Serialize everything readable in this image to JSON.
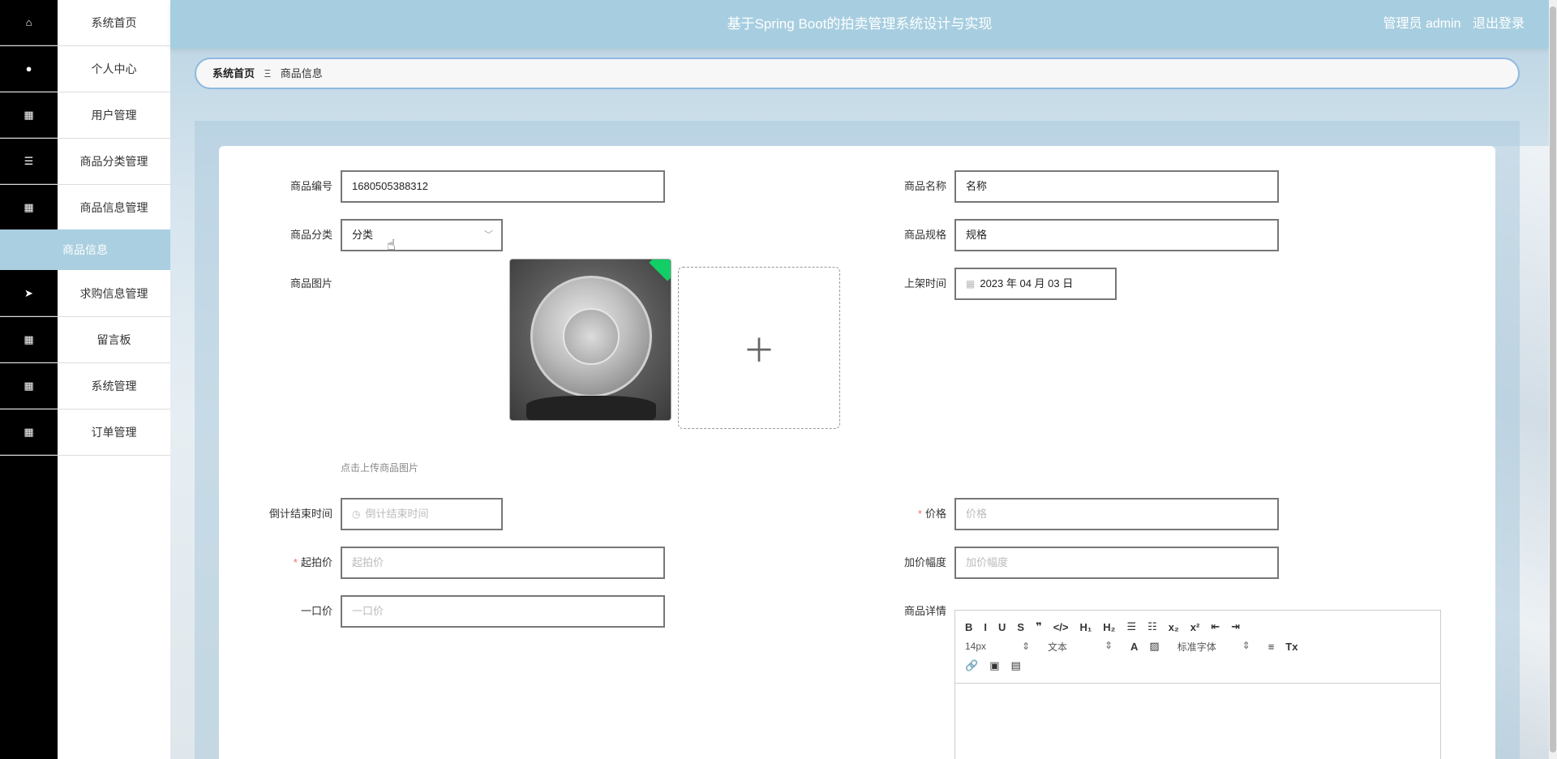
{
  "app": {
    "title": "基于Spring Boot的拍卖管理系统设计与实现",
    "user_label": "管理员 admin",
    "logout": "退出登录"
  },
  "sidebar": {
    "items": [
      {
        "label": "系统首页",
        "icon": "home-icon"
      },
      {
        "label": "个人中心",
        "icon": "user-icon"
      },
      {
        "label": "用户管理",
        "icon": "grid-icon"
      },
      {
        "label": "商品分类管理",
        "icon": "sliders-icon"
      },
      {
        "label": "商品信息管理",
        "icon": "grid-icon"
      },
      {
        "label": "求购信息管理",
        "icon": "send-icon"
      },
      {
        "label": "留言板",
        "icon": "grid-icon"
      },
      {
        "label": "系统管理",
        "icon": "table-icon"
      },
      {
        "label": "订单管理",
        "icon": "grid-icon"
      }
    ],
    "active_sub": "商品信息"
  },
  "breadcrumb": {
    "home": "系统首页",
    "sep": "Ξ",
    "current": "商品信息"
  },
  "form": {
    "code_label": "商品编号",
    "code_value": "1680505388312",
    "name_label": "商品名称",
    "name_value": "名称",
    "category_label": "商品分类",
    "category_value": "分类",
    "spec_label": "商品规格",
    "spec_value": "规格",
    "image_label": "商品图片",
    "image_hint": "点击上传商品图片",
    "shelf_label": "上架时间",
    "shelf_value": "2023 年 04 月 03 日",
    "countdown_label": "倒计结束时间",
    "countdown_placeholder": "倒计结束时间",
    "price_label": "价格",
    "price_placeholder": "价格",
    "start_label": "起拍价",
    "start_placeholder": "起拍价",
    "increment_label": "加价幅度",
    "increment_placeholder": "加价幅度",
    "buyout_label": "一口价",
    "buyout_placeholder": "一口价",
    "detail_label": "商品详情"
  },
  "editor": {
    "row1": [
      "B",
      "I",
      "U",
      "S",
      "❞",
      "</>",
      "H₁",
      "H₂",
      "☰",
      "☷",
      "x₂",
      "x²",
      "⇤",
      "⇥"
    ],
    "size": "14px",
    "type": "文本",
    "font": "标准字体",
    "row2_icons": [
      "A",
      "▨",
      "≡",
      "Tx"
    ],
    "row3": [
      "🔗",
      "▣",
      "▤"
    ]
  }
}
